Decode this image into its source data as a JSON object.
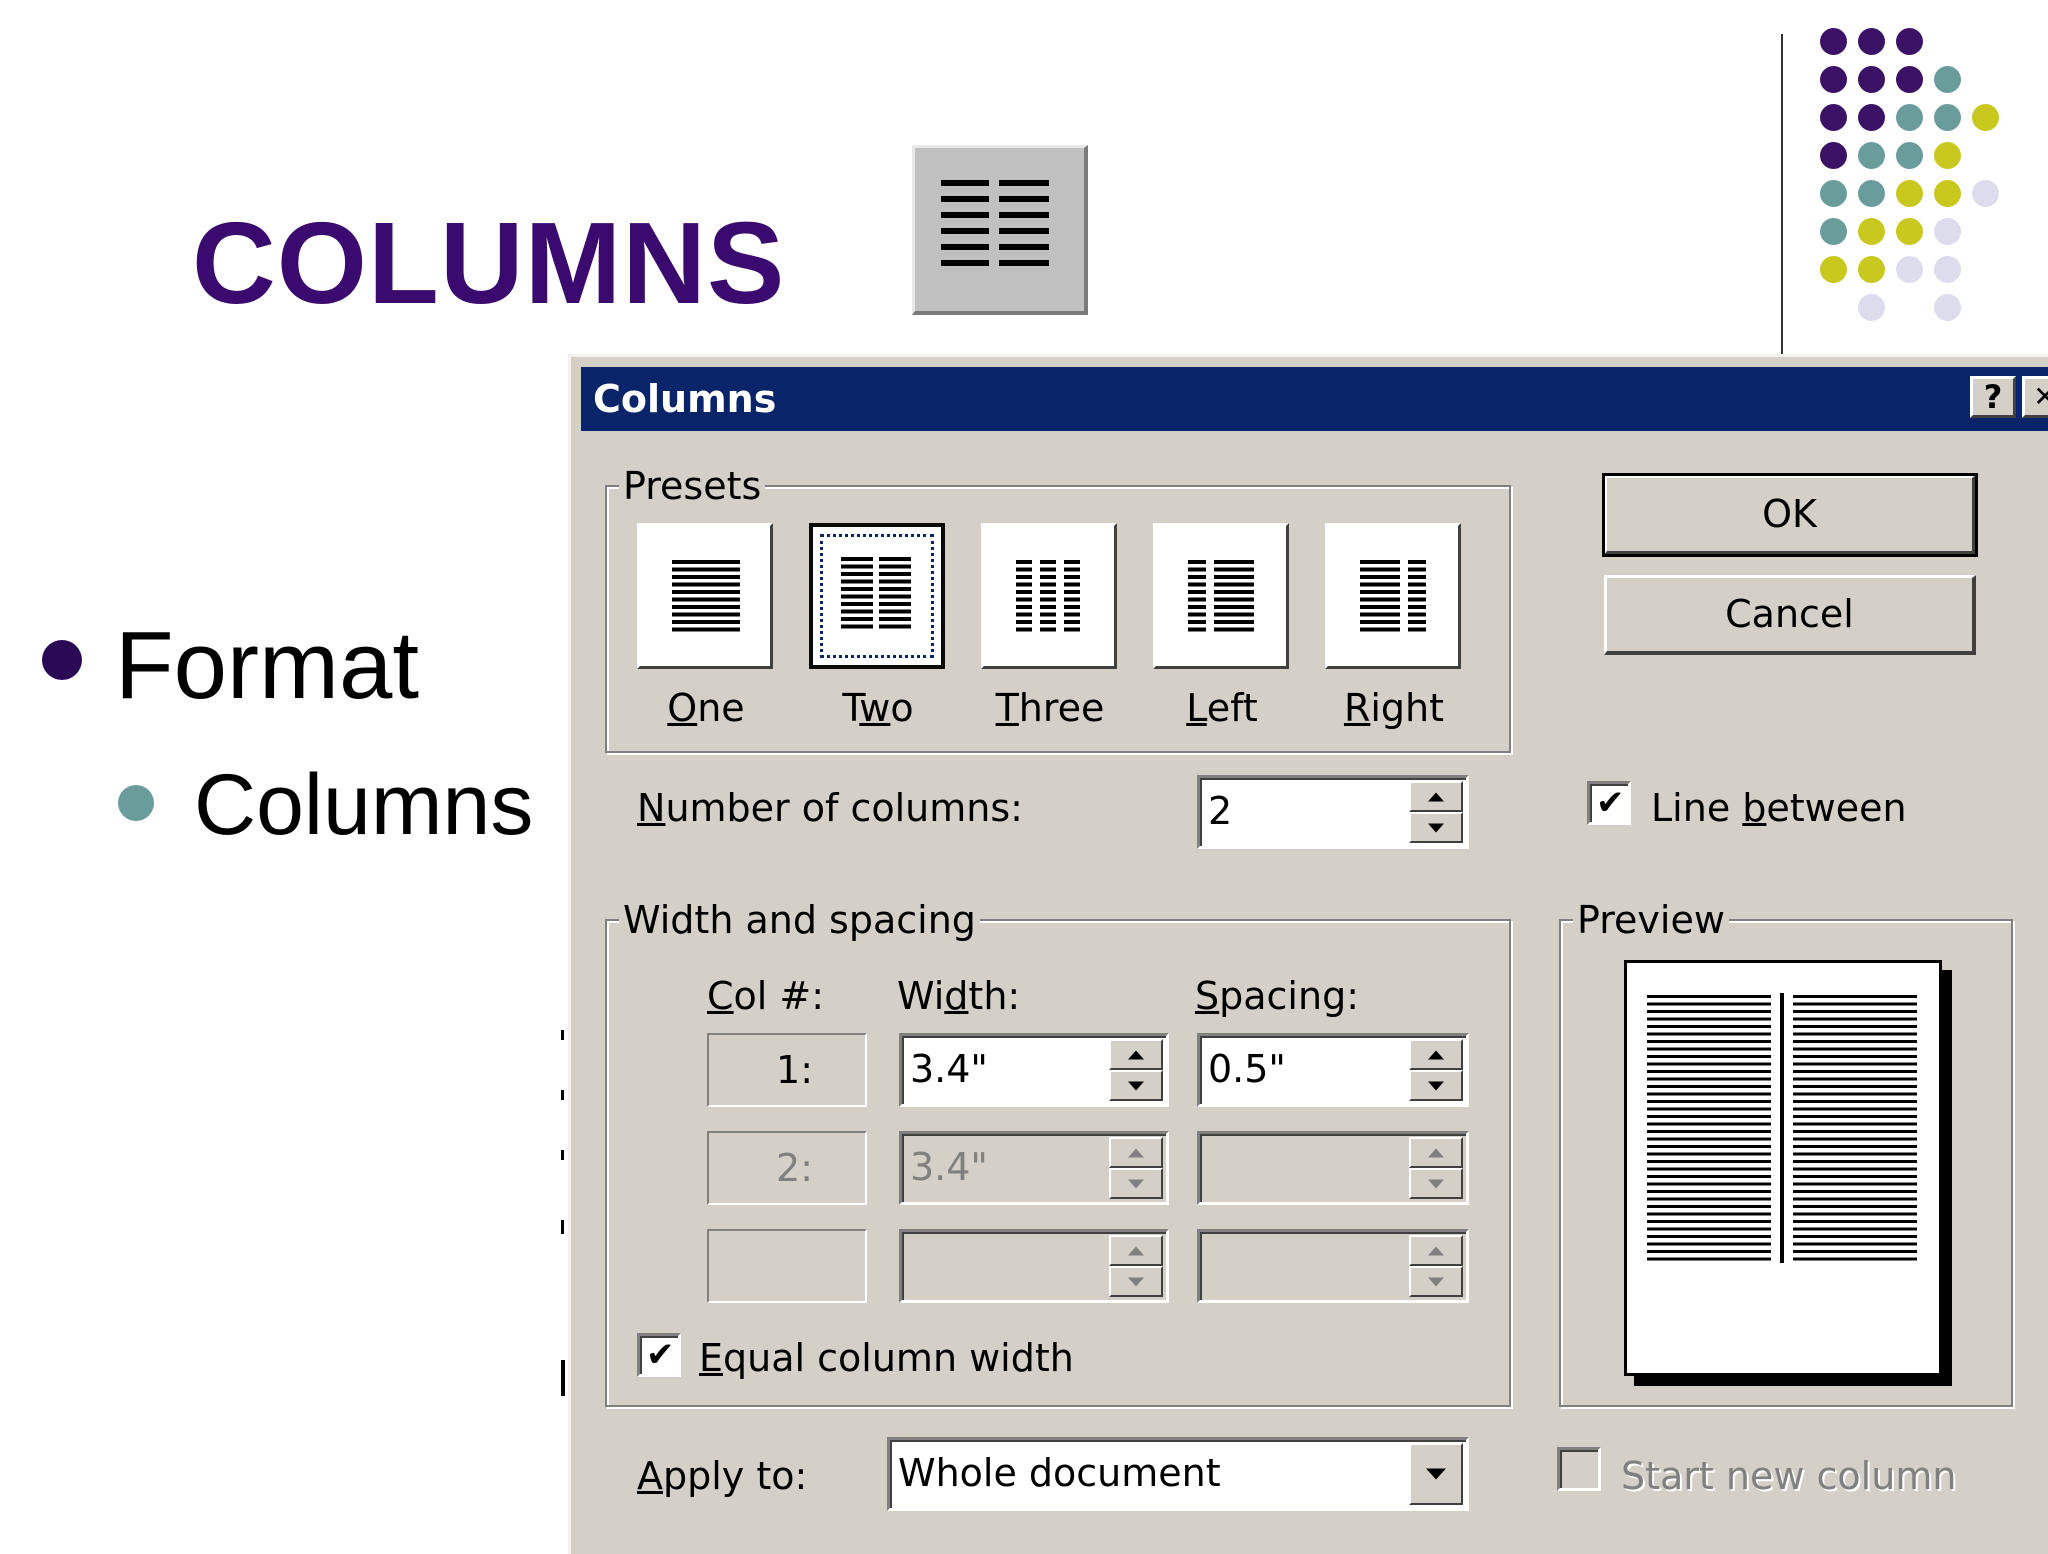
{
  "slide": {
    "title": "COLUMNS",
    "bullets": [
      {
        "text": "Format",
        "level": 1
      },
      {
        "text": "Columns",
        "level": 2
      }
    ]
  },
  "colors": {
    "title": "#3a0a6e",
    "dot_purple": "#3b1266",
    "dot_teal": "#6b9c9c",
    "dot_yellow": "#c8c81e",
    "dot_lavender": "#dcdcec",
    "dialog_titlebar": "#0a246a",
    "dialog_face": "#d4d0c8"
  },
  "dialog": {
    "title": "Columns",
    "help_button": "?",
    "close_button": "✕",
    "presets": {
      "legend": "Presets",
      "items": [
        {
          "label": "One",
          "accel": "O",
          "selected": false
        },
        {
          "label": "Two",
          "accel": "w",
          "selected": true
        },
        {
          "label": "Three",
          "accel": "T",
          "selected": false
        },
        {
          "label": "Left",
          "accel": "L",
          "selected": false
        },
        {
          "label": "Right",
          "accel": "R",
          "selected": false
        }
      ]
    },
    "ok_label": "OK",
    "cancel_label": "Cancel",
    "number_of_columns": {
      "label": "Number of columns:",
      "value": "2"
    },
    "line_between": {
      "label": "Line between",
      "checked": true
    },
    "width_spacing": {
      "legend": "Width and spacing",
      "col_header": "Col #:",
      "width_header": "Width:",
      "spacing_header": "Spacing:",
      "rows": [
        {
          "col": "1:",
          "width": "3.4\"",
          "spacing": "0.5\"",
          "enabled": true
        },
        {
          "col": "2:",
          "width": "3.4\"",
          "spacing": "",
          "enabled": false
        },
        {
          "col": "",
          "width": "",
          "spacing": "",
          "enabled": false
        }
      ]
    },
    "equal_column_width": {
      "label": "Equal column width",
      "checked": true
    },
    "preview": {
      "legend": "Preview"
    },
    "apply_to": {
      "label": "Apply to:",
      "value": "Whole document"
    },
    "start_new_column": {
      "label": "Start new column",
      "checked": false,
      "enabled": false
    }
  }
}
